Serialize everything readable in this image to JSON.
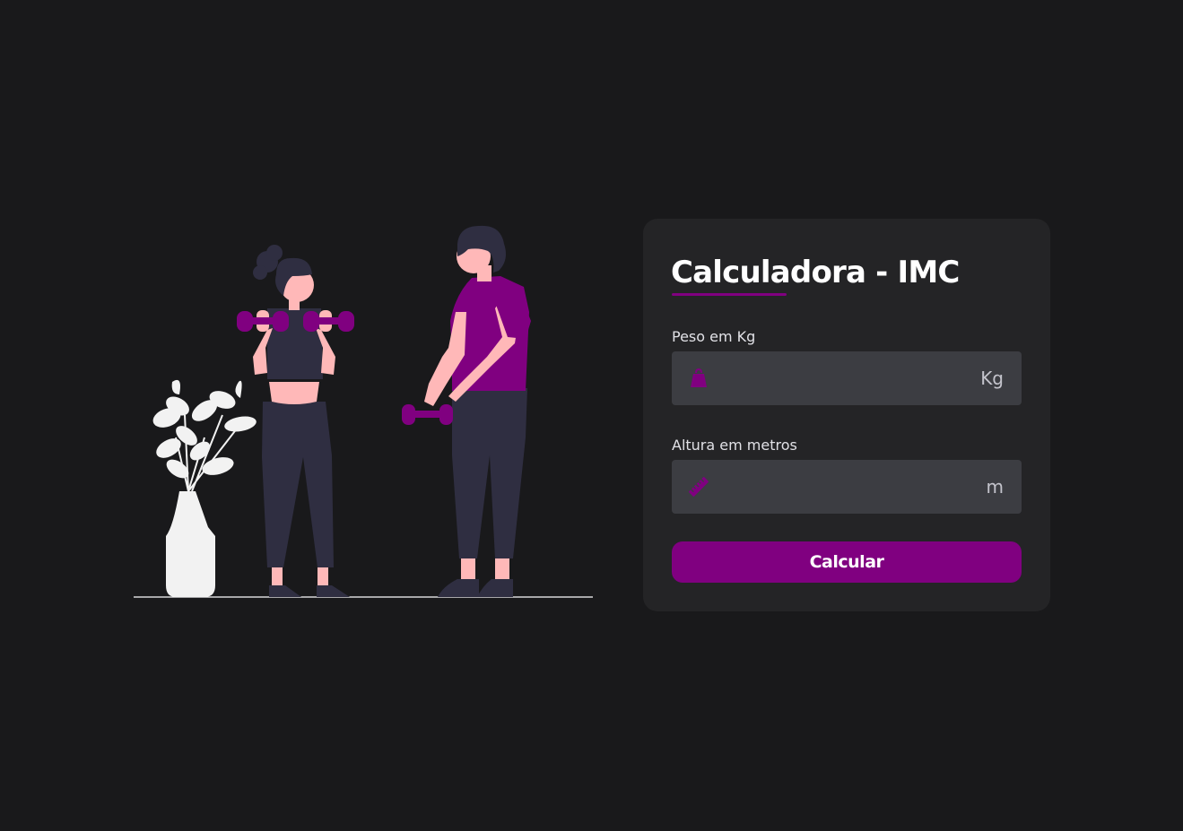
{
  "calculator": {
    "title": "Calculadora - IMC",
    "weight": {
      "label": "Peso em Kg",
      "placeholder": "",
      "value": "",
      "unit": "Kg",
      "icon": "weight-icon"
    },
    "height": {
      "label": "Altura em metros",
      "placeholder": "",
      "value": "",
      "unit": "m",
      "icon": "ruler-icon"
    },
    "submit_label": "Calcular"
  },
  "colors": {
    "background": "#19191b",
    "card": "#242426",
    "accent": "#800080",
    "input_background": "#3c3d42"
  }
}
